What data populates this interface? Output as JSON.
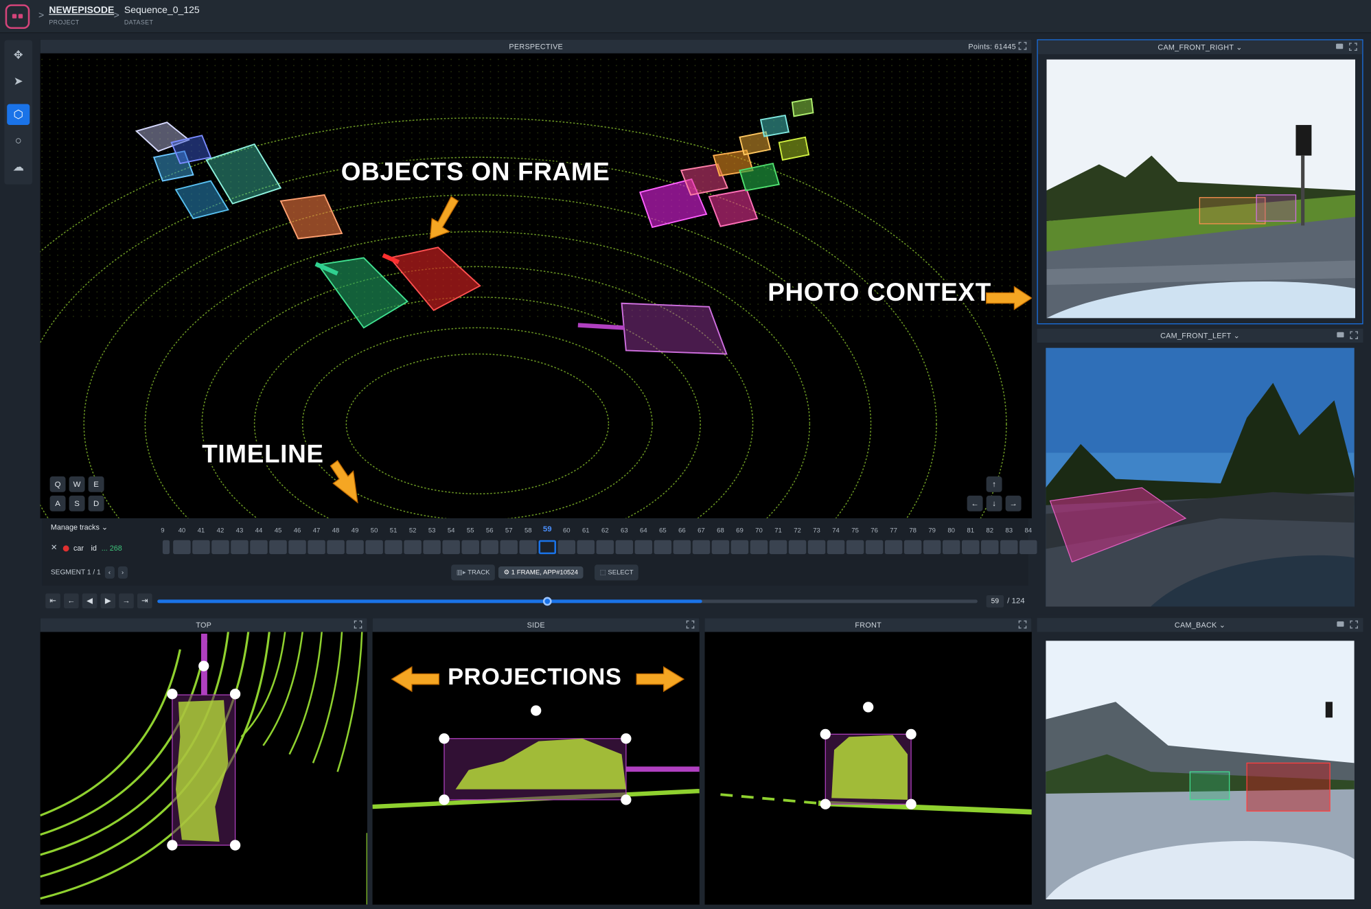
{
  "breadcrumb": {
    "project_name": "NEWEPISODE",
    "project_label": "PROJECT",
    "dataset_name": "Sequence_0_125",
    "dataset_label": "DATASET",
    "separator": ">"
  },
  "toolbar": {
    "icons": [
      "move-icon",
      "cursor-icon",
      "cuboid-icon",
      "circle-icon",
      "cloud-icon"
    ],
    "glyphs": [
      "✥",
      "➤",
      "⬡",
      "○",
      "☁"
    ],
    "active_index": 2
  },
  "perspective": {
    "title": "PERSPECTIVE",
    "points_label": "Points: 61445",
    "keys": [
      "Q",
      "W",
      "E",
      "A",
      "S",
      "D"
    ],
    "nav_arrows": [
      "↑",
      "←",
      "↓",
      "→"
    ]
  },
  "cameras": [
    {
      "name": "CAM_FRONT_RIGHT ⌄"
    },
    {
      "name": "CAM_FRONT_LEFT ⌄"
    },
    {
      "name": "CAM_BACK ⌄"
    }
  ],
  "views": {
    "top": "TOP",
    "side": "SIDE",
    "front": "FRONT"
  },
  "annotations": {
    "objects": "OBJECTS ON FRAME",
    "photo_context": "PHOTO CONTEXT",
    "timeline": "TIMELINE",
    "projections": "PROJECTIONS"
  },
  "timeline": {
    "manage_tracks": "Manage tracks ⌄",
    "track_close": "✕",
    "track_class": "car",
    "track_id_label": "id",
    "track_id": "... 268",
    "segment": "SEGMENT 1 / 1",
    "segment_nav": [
      "‹",
      "›"
    ],
    "frames": [
      "9",
      "40",
      "41",
      "42",
      "43",
      "44",
      "45",
      "46",
      "47",
      "48",
      "49",
      "50",
      "51",
      "52",
      "53",
      "54",
      "55",
      "56",
      "57",
      "58",
      "59",
      "60",
      "61",
      "62",
      "63",
      "64",
      "65",
      "66",
      "67",
      "68",
      "69",
      "70",
      "71",
      "72",
      "73",
      "74",
      "75",
      "76",
      "77",
      "78",
      "79",
      "80",
      "81",
      "82",
      "83",
      "84"
    ],
    "current_frame": "59",
    "track_button": "TRACK",
    "frame_info": "⚙ 1 FRAME, APP#10524",
    "select_button": "SELECT"
  },
  "playback": {
    "buttons": [
      "⇤",
      "←",
      "◀",
      "▶",
      "→",
      "⇥"
    ],
    "current": "59",
    "total": "/ 124",
    "progress": 0.476,
    "buffered": 0.664
  },
  "colors": {
    "accent": "#1a73e8",
    "brand": "#d4447a",
    "lidar": "#9acd32",
    "selected_box": "#a23ca8"
  }
}
